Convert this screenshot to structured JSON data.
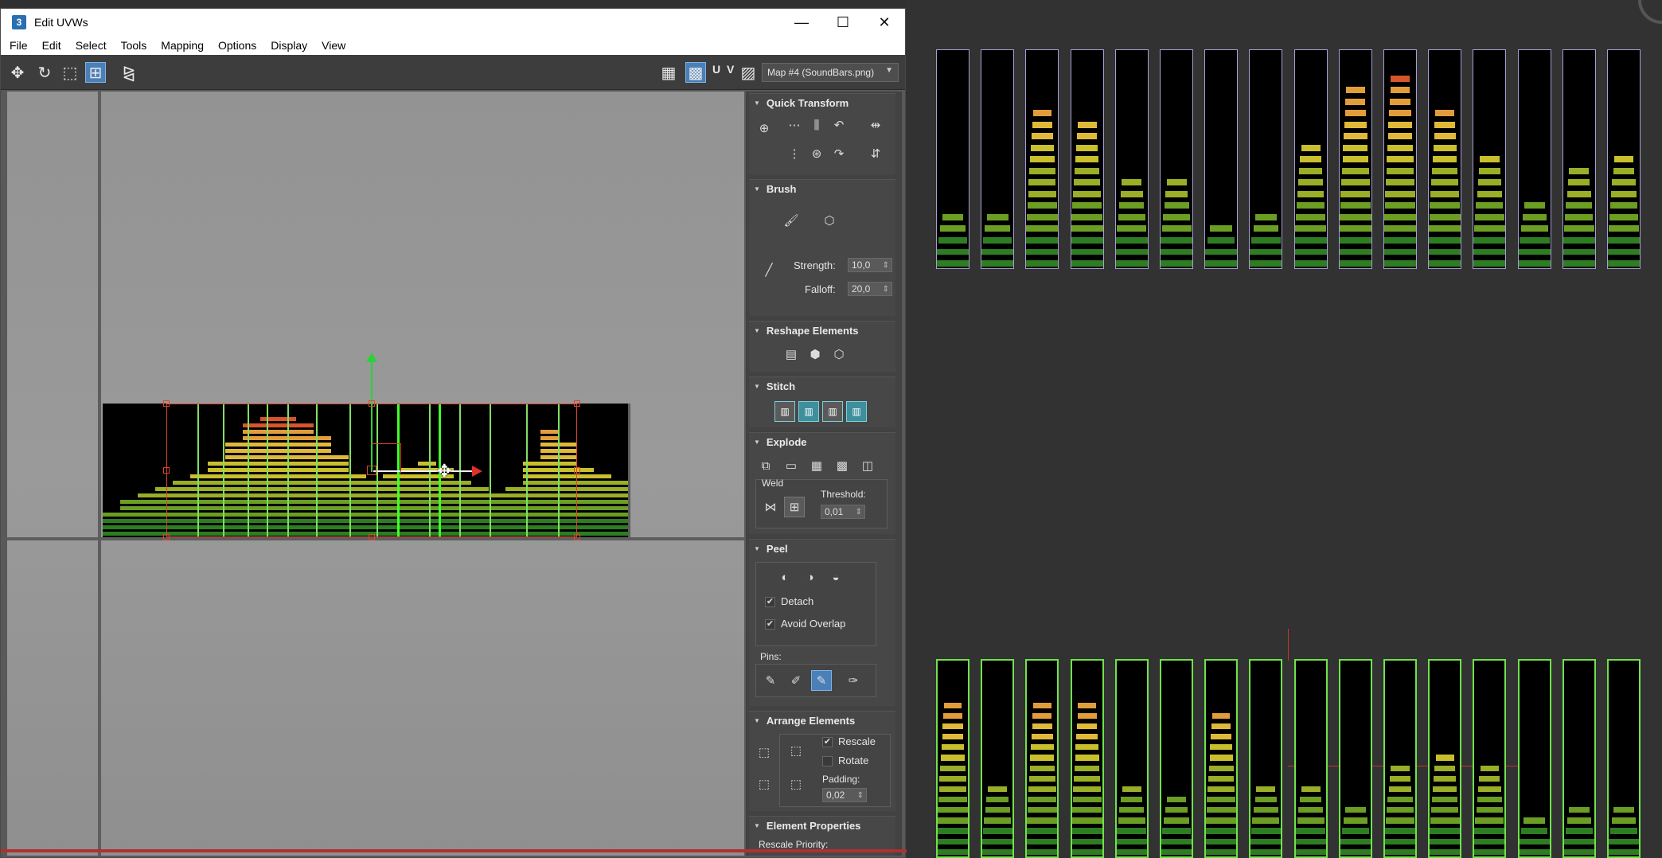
{
  "window": {
    "title": "Edit UVWs",
    "app_icon": "3",
    "minimize": "—",
    "maximize": "☐",
    "close": "✕"
  },
  "menu": [
    "File",
    "Edit",
    "Select",
    "Tools",
    "Mapping",
    "Options",
    "Display",
    "View"
  ],
  "toolbar": {
    "uv_label": "U V",
    "map_selector": "Map #4 (SoundBars.png)"
  },
  "panel": {
    "quick_transform": {
      "title": "Quick Transform"
    },
    "brush": {
      "title": "Brush",
      "strength_label": "Strength:",
      "strength_value": "10,0",
      "falloff_label": "Falloff:",
      "falloff_value": "20,0"
    },
    "reshape": {
      "title": "Reshape Elements"
    },
    "stitch": {
      "title": "Stitch"
    },
    "explode": {
      "title": "Explode",
      "weld_label": "Weld",
      "threshold_label": "Threshold:",
      "threshold_value": "0,01"
    },
    "peel": {
      "title": "Peel",
      "detach_label": "Detach",
      "detach_checked": true,
      "avoid_overlap_label": "Avoid Overlap",
      "avoid_overlap_checked": true,
      "pins_label": "Pins:"
    },
    "arrange": {
      "title": "Arrange Elements",
      "rescale_label": "Rescale",
      "rescale_checked": true,
      "rotate_label": "Rotate",
      "rotate_checked": false,
      "padding_label": "Padding:",
      "padding_value": "0,02"
    },
    "element_properties": {
      "title": "Element Properties",
      "rescale_priority_label": "Rescale Priority:"
    }
  },
  "colors": {
    "uv_seam": "#41ff2a",
    "selection": "#e0442a",
    "gizmo_y": "#2bd13b",
    "gizmo_x": "#e0302a",
    "top_bar_outline": "#a79fd3",
    "bottom_bar_outline": "#6fe24a"
  },
  "viewport": {
    "top_bar_levels": [
      0.3,
      0.25,
      0.8,
      0.7,
      0.45,
      0.45,
      0.2,
      0.3,
      0.6,
      0.9,
      0.95,
      0.75,
      0.55,
      0.35,
      0.5,
      0.55
    ],
    "bottom_bar_levels": [
      0.85,
      0.4,
      0.85,
      0.85,
      0.4,
      0.35,
      0.8,
      0.4,
      0.4,
      0.3,
      0.5,
      0.55,
      0.5,
      0.2,
      0.3,
      0.3
    ]
  }
}
